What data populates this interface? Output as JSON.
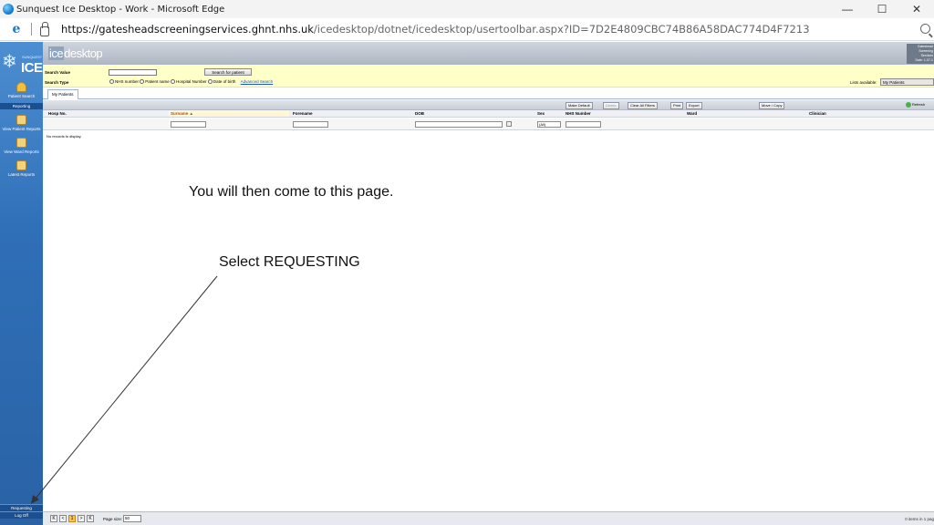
{
  "window": {
    "title": "Sunquest Ice Desktop - Work - Microsoft Edge",
    "controls": {
      "minimize": "—",
      "maximize": "☐",
      "close": "✕"
    }
  },
  "addressbar": {
    "url_host": "https://gatesheadscreeningservices.ghnt.nhs.uk",
    "url_path": "/icedesktop/dotnet/icedesktop/usertoolbar.aspx?ID=7D2E4809CBC74B86A58DAC774D4F7213"
  },
  "sidebar": {
    "logo_small": "SUNQUEST",
    "logo_text": "ICE",
    "items": [
      {
        "label": "Patient Search"
      },
      {
        "label": "View Patient Reports"
      },
      {
        "label": "View Ward Reports"
      },
      {
        "label": "Latest Reports"
      }
    ],
    "section_header": "Reporting",
    "bottom": {
      "requesting": "Requesting",
      "logoff": "Log Off"
    }
  },
  "banner": {
    "brand_ice": "ice",
    "brand_rest": "desktop",
    "user_lines": [
      "Gateshead",
      "Screening",
      "Services",
      "Date: 1-07-1"
    ]
  },
  "search": {
    "value_label": "Search Value",
    "type_label": "Search Type",
    "button": "Search for patient",
    "options": [
      "NHS number",
      "Patient name",
      "Hospital Number",
      "Date of birth"
    ],
    "advanced": "Advanced Search",
    "lists_label": "Lists available:",
    "lists_value": "My Patients"
  },
  "tabs": [
    "My Patients"
  ],
  "toolbar": {
    "make_default": "Make Default",
    "delete": "Delete",
    "clear_filters": "Clear All Filters",
    "print": "Print",
    "export": "Export",
    "move_copy": "Move / Copy",
    "refresh": "Refresh"
  },
  "grid": {
    "columns": [
      "Hosp No.",
      "Surname ▲",
      "Forename",
      "DOB",
      "Sex",
      "NHS Number",
      "Ward",
      "Clinician"
    ],
    "sex_filter": "(All)",
    "empty": "No records to display."
  },
  "annotations": {
    "line1": "You will then come to this page.",
    "line2": "Select REQUESTING"
  },
  "pager": {
    "first": "K",
    "prev": "<",
    "page": "1",
    "next": ">",
    "last": "K",
    "size_label": "Page size:",
    "size_value": "50",
    "info": "0 items in 1 pag"
  }
}
